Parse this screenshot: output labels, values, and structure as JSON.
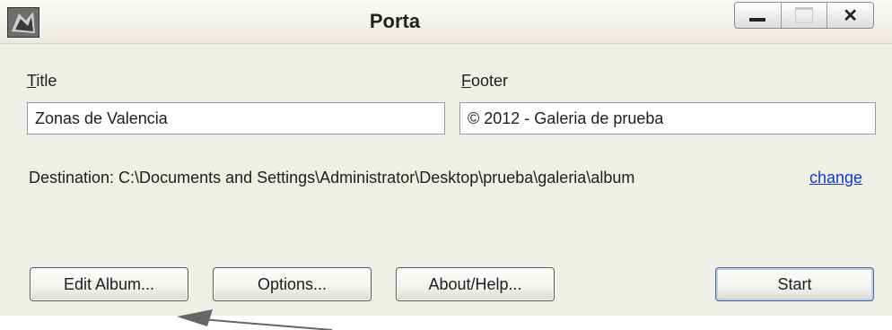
{
  "window": {
    "title": "Porta",
    "controls": {
      "minimize": "minimize",
      "maximize": "maximize",
      "close": "✕"
    }
  },
  "form": {
    "title_label": "Title",
    "title_value": "Zonas de Valencia",
    "footer_label": "Footer",
    "footer_value": "© 2012 - Galeria de prueba",
    "destination_text": "Destination:  C:\\Documents and Settings\\Administrator\\Desktop\\prueba\\galeria\\album",
    "change_link": "change"
  },
  "buttons": {
    "edit_album": "Edit Album...",
    "options": "Options...",
    "about_help": "About/Help...",
    "start": "Start"
  },
  "colors": {
    "window_bg": "#f0efe6",
    "link": "#0b3bd6",
    "arrow": "#666666"
  },
  "icons": [
    "app-icon",
    "minimize-icon",
    "maximize-icon",
    "close-icon",
    "pointer-arrow"
  ]
}
